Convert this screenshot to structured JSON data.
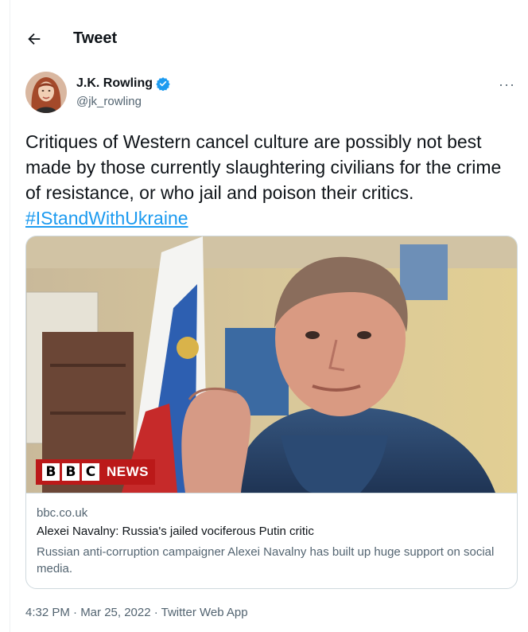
{
  "header": {
    "title": "Tweet",
    "back_icon": "arrow-left-icon"
  },
  "author": {
    "name": "J.K. Rowling",
    "handle": "@jk_rowling",
    "verified": true,
    "more_icon": "more-horizontal-icon",
    "more_label": "···"
  },
  "tweet": {
    "text": "Critiques of Western cancel culture are possibly not best made by those currently slaughtering civilians for the crime of resistance, or who jail and poison their critics.",
    "hashtag": "#IStandWithUkraine"
  },
  "card": {
    "badge_letters": [
      "B",
      "B",
      "C"
    ],
    "badge_word": "NEWS",
    "domain": "bbc.co.uk",
    "title": "Alexei Navalny: Russia's jailed vociferous Putin critic",
    "description": "Russian anti-corruption campaigner Alexei Navalny has built up huge support on social media."
  },
  "footer": {
    "timestamp": "4:32 PM · Mar 25, 2022 · Twitter Web App"
  },
  "colors": {
    "link": "#1d9bf0",
    "secondary_text": "#536471",
    "border": "#cfd9de",
    "bbc_red": "#bb1919"
  }
}
